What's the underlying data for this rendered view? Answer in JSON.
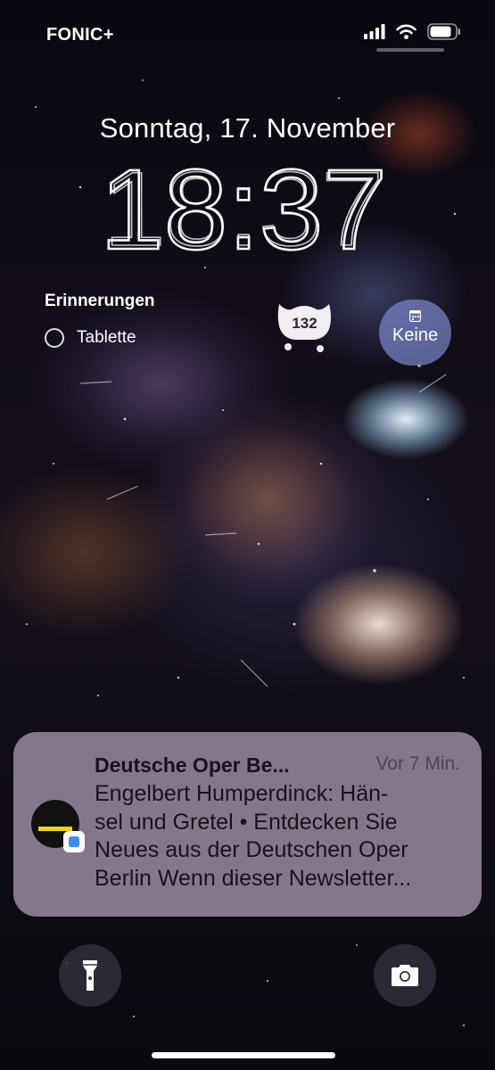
{
  "status_bar": {
    "carrier": "FONIC+",
    "signal_icon": "signal-bars-icon",
    "wifi_icon": "wifi-icon",
    "battery_icon": "battery-icon"
  },
  "lock_screen": {
    "date": "Sonntag, 17. November",
    "time": "18:37"
  },
  "widgets": {
    "reminders": {
      "title": "Erinnerungen",
      "item": "Tablette"
    },
    "badge": {
      "count": "132"
    },
    "calendar": {
      "label": "Keine",
      "icon": "calendar-icon"
    }
  },
  "notification": {
    "app": "Deutsche Oper Be...",
    "time": "Vor 7 Min.",
    "body_lines": [
      "Engelbert Humperdinck: Hän-",
      "sel und Gretel • Entdecken Sie",
      "Neues aus der Deutschen Oper",
      "Berlin Wenn dieser Newsletter..."
    ],
    "accent_color": "#f3d21e"
  },
  "quick_actions": {
    "flashlight_icon": "flashlight-icon",
    "camera_icon": "camera-icon"
  }
}
